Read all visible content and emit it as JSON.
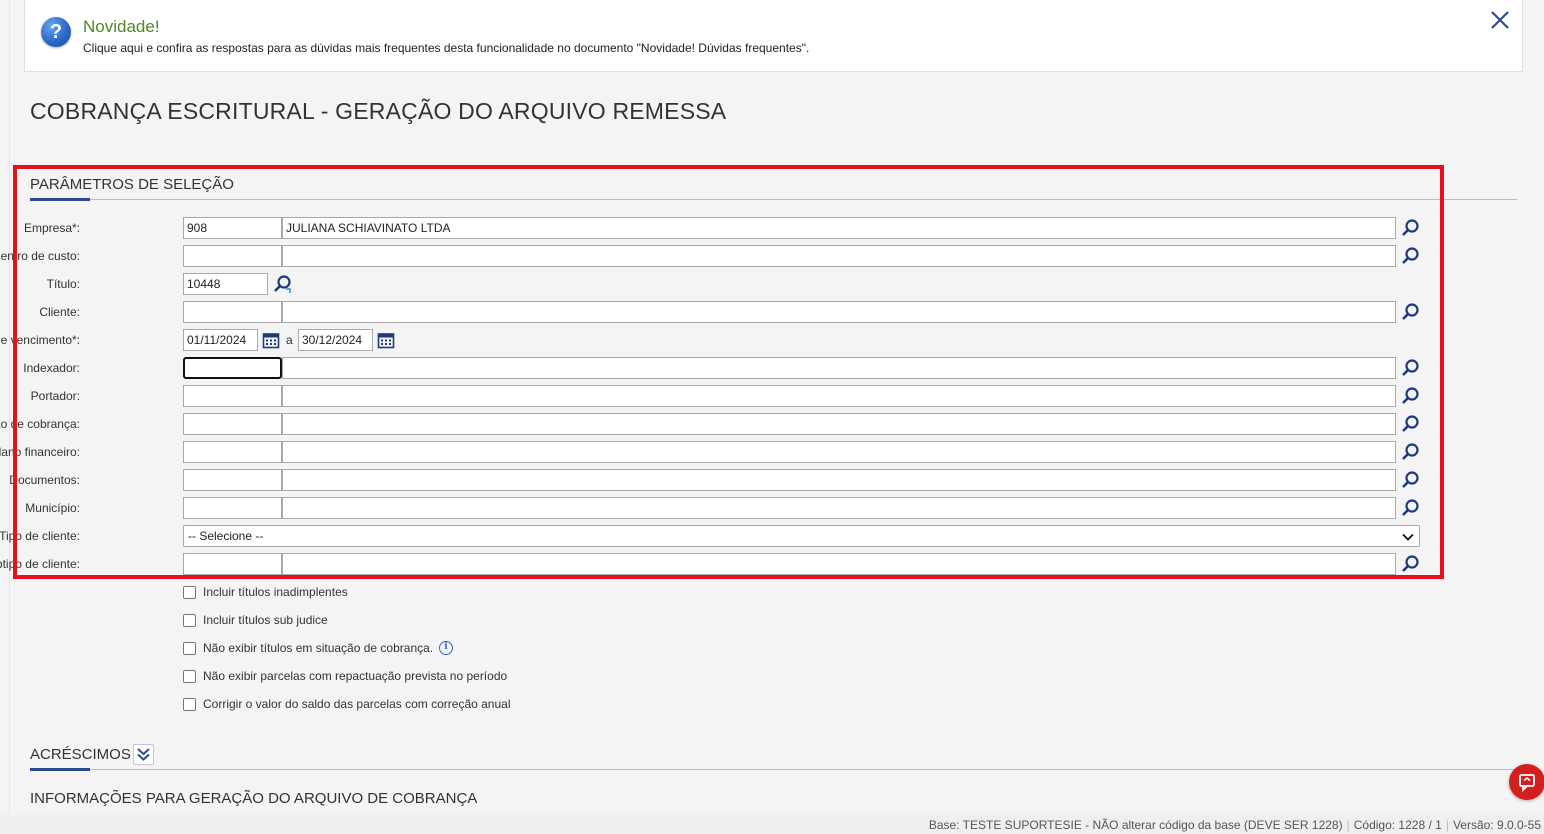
{
  "notice": {
    "title": "Novidade!",
    "text": "Clique aqui e confira as respostas para as dúvidas mais frequentes desta funcionalidade no documento \"Novidade! Dúvidas frequentes\".",
    "icon": "question-icon"
  },
  "page": {
    "title": "COBRANÇA ESCRITURAL - GERAÇÃO DO ARQUIVO REMESSA"
  },
  "sections": {
    "params": "PARÂMETROS DE SELEÇÃO",
    "acrescimos": "ACRÉSCIMOS",
    "info": "INFORMAÇÕES PARA GERAÇÃO DO ARQUIVO DE COBRANÇA"
  },
  "fields": {
    "empresa": {
      "label": "Empresa*:",
      "code": "908",
      "desc": "JULIANA SCHIAVINATO LTDA"
    },
    "centro_custo": {
      "label": "Centro de custo:",
      "code": "",
      "desc": ""
    },
    "titulo": {
      "label": "Título:",
      "code": "10448"
    },
    "cliente": {
      "label": "Cliente:",
      "code": "",
      "desc": ""
    },
    "periodo": {
      "label": "Período de vencimento*:",
      "from": "01/11/2024",
      "sep": "a",
      "to": "30/12/2024"
    },
    "indexador": {
      "label": "Indexador:",
      "code": "",
      "desc": ""
    },
    "portador": {
      "label": "Portador:",
      "code": "",
      "desc": ""
    },
    "operacao": {
      "label": "Operação de cobrança:",
      "code": "",
      "desc": ""
    },
    "plano": {
      "label": "Plano financeiro:",
      "code": "",
      "desc": ""
    },
    "documentos": {
      "label": "Documentos:",
      "code": "",
      "desc": ""
    },
    "municipio": {
      "label": "Município:",
      "code": "",
      "desc": ""
    },
    "tipo_cliente": {
      "label": "Tipo de cliente:",
      "selected": "-- Selecione --"
    },
    "subtipo": {
      "label": "Subtipo de cliente:",
      "code": "",
      "desc": ""
    }
  },
  "checkboxes": [
    {
      "label": "Incluir títulos inadimplentes",
      "checked": false
    },
    {
      "label": "Incluir títulos sub judice",
      "checked": false
    },
    {
      "label": "Não exibir títulos em situação de cobrança.",
      "checked": false
    },
    {
      "label": "Não exibir parcelas com repactuação prevista no período",
      "checked": false
    },
    {
      "label": "Corrigir o valor do saldo das parcelas com correção anual",
      "checked": false
    }
  ],
  "footer": {
    "base": "Base: TESTE SUPORTESIE - NÃO alterar código da base (DEVE SER 1228)",
    "codigo": "Código: 1228 / 1",
    "versao": "Versão: 9.0.0-55"
  },
  "colors": {
    "accent": "#2b4a8f",
    "highlight": "#e4101c",
    "notice_title": "#4d8a24",
    "fab": "#d3201e"
  }
}
